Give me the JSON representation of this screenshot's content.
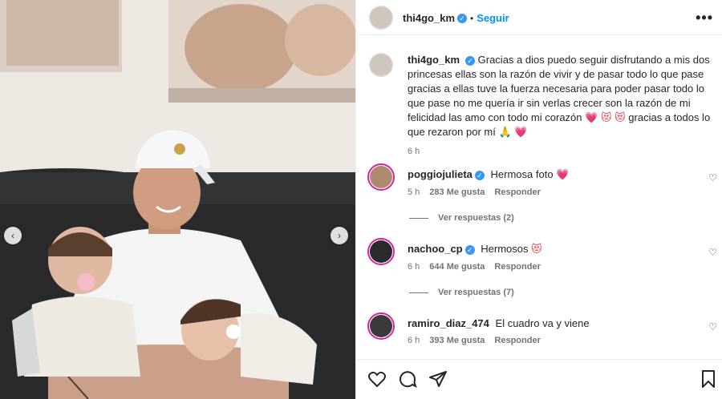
{
  "post": {
    "author": "thi4go_km",
    "follow_label": "Seguir",
    "dot": "•",
    "more": "•••",
    "verified_mark": "✓",
    "caption_text": "Gracias a dios puedo seguir disfrutando a mis dos princesas ellas son la razón de vivir y de pasar todo lo que pase gracias a ellas tuve la fuerza necesaria para poder pasar todo lo que pase no me quería ir sin verlas crecer son la razón de mi felicidad las amo con todo mi corazón",
    "caption_emojis_1": "💗 😻 😻",
    "caption_tail": "gracias a todos lo que rezaron por mí",
    "caption_emojis_2": "🙏 💗",
    "caption_time": "6 h"
  },
  "comments": [
    {
      "user": "poggiojulieta",
      "text": "Hermosa foto",
      "emoji": "💗",
      "time": "5 h",
      "likes": "283 Me gusta",
      "reply": "Responder",
      "replies_label": "Ver respuestas (2)"
    },
    {
      "user": "nachoo_cp",
      "text": "Hermosos",
      "emoji": "😻",
      "time": "6 h",
      "likes": "644 Me gusta",
      "reply": "Responder",
      "replies_label": "Ver respuestas (7)"
    },
    {
      "user": "ramiro_diaz_474",
      "text": "El cuadro va y viene",
      "emoji": "",
      "time": "6 h",
      "likes": "393 Me gusta",
      "reply": "Responder"
    }
  ],
  "nav": {
    "prev": "‹",
    "next": "›"
  },
  "icons": {
    "like": "heart-icon",
    "comment": "comment-icon",
    "share": "share-icon",
    "save": "bookmark-icon"
  },
  "colors": {
    "link_blue": "#0095f6",
    "verified_blue": "#3897f0",
    "story_ring": "#d6249f",
    "heart_red": "#ed4956"
  }
}
